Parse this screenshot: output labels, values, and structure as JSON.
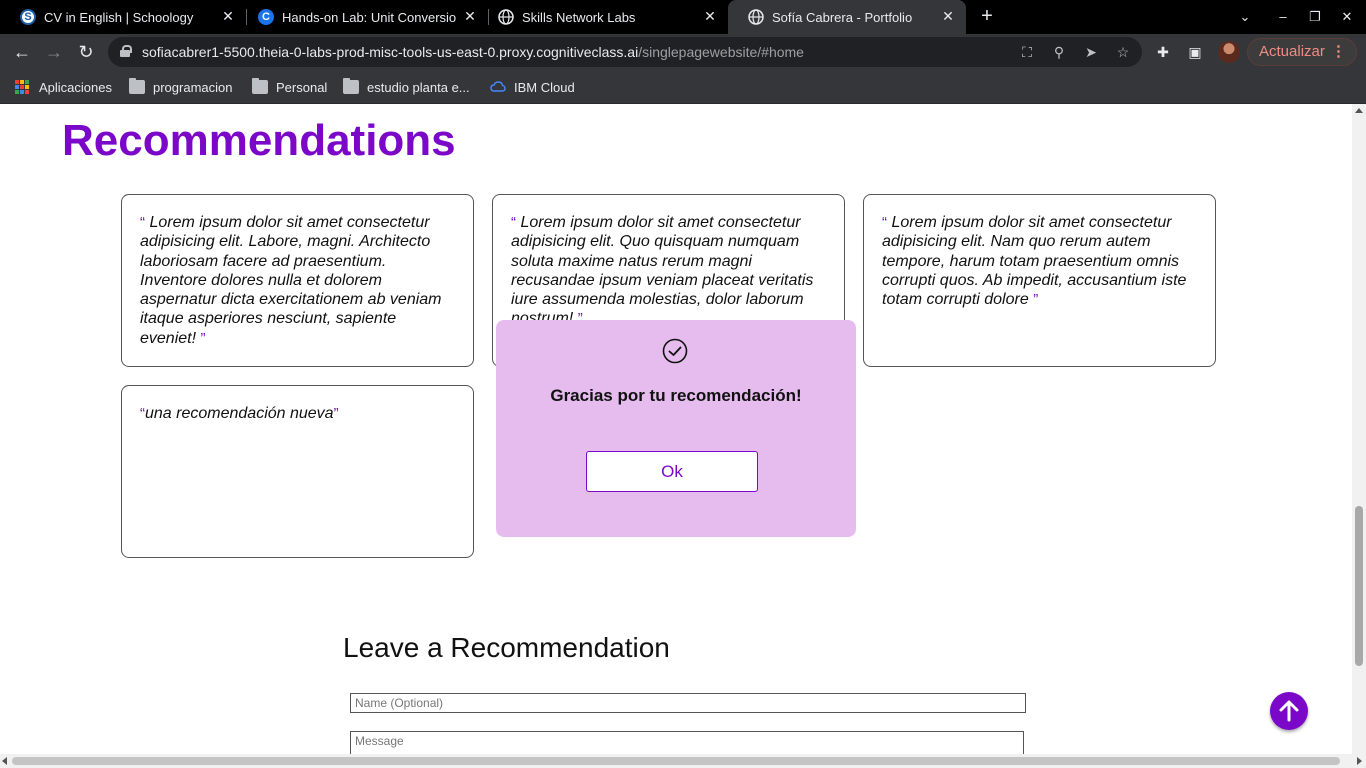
{
  "browser": {
    "tabs": [
      {
        "title": "CV in English | Schoology",
        "favicon": "schoology-icon"
      },
      {
        "title": "Hands-on Lab: Unit Conversion",
        "favicon": "cognitiveclass-icon"
      },
      {
        "title": "Skills Network Labs",
        "favicon": "globe-icon"
      },
      {
        "title": "Sofía Cabrera - Portfolio",
        "favicon": "globe-icon",
        "active": true
      }
    ],
    "url_host": "sofiacabrer1-5500.theia-0-labs-prod-misc-tools-us-east-0.proxy.cognitiveclass.ai",
    "url_path": "/singlepagewebsite/#home",
    "update_label": "Actualizar",
    "bookmarks": [
      {
        "label": "Aplicaciones",
        "icon": "apps-grid-icon"
      },
      {
        "label": "programacion",
        "icon": "folder-icon"
      },
      {
        "label": "Personal",
        "icon": "folder-icon"
      },
      {
        "label": "estudio planta e...",
        "icon": "folder-icon"
      },
      {
        "label": "IBM Cloud",
        "icon": "ibm-cloud-icon"
      }
    ]
  },
  "page": {
    "heading": "Recommendations",
    "open_quote": "“",
    "close_quote": "”",
    "recommendations": [
      "Lorem ipsum dolor sit amet consectetur adipisicing elit. Labore, magni. Architecto laboriosam facere ad praesentium. Inventore dolores nulla et dolorem aspernatur dicta exercitationem ab veniam itaque asperiores nesciunt, sapiente eveniet!",
      "Lorem ipsum dolor sit amet consectetur adipisicing elit. Quo quisquam numquam soluta maxime natus rerum magni recusandae ipsum veniam placeat veritatis iure assumenda molestias, dolor laborum nostrum!",
      "Lorem ipsum dolor sit amet consectetur adipisicing elit. Nam quo rerum autem tempore, harum totam praesentium omnis corrupti quos. Ab impedit, accusantium iste totam corrupti dolore",
      "una recomendación nueva"
    ],
    "leave_heading": "Leave a Recommendation",
    "name_placeholder": "Name (Optional)",
    "message_placeholder": "Message"
  },
  "modal": {
    "message": "Gracias por tu recomendación!",
    "ok_label": "Ok",
    "icon": "check-circle-icon"
  },
  "colors": {
    "accent": "#7b08c9",
    "modal_bg": "#e6bcef",
    "chrome_dark": "#35363a",
    "update_text": "#f28b82"
  }
}
